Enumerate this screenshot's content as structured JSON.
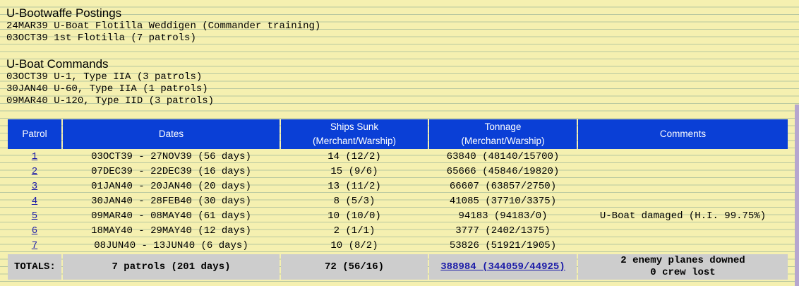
{
  "postings": {
    "title": "U-Bootwaffe Postings",
    "items": [
      "24MAR39 U-Boat Flotilla Weddigen (Commander training)",
      "03OCT39 1st Flotilla (7 patrols)"
    ]
  },
  "commands": {
    "title": "U-Boat Commands",
    "items": [
      "03OCT39 U-1, Type IIA (3 patrols)",
      "30JAN40 U-60, Type IIA (1 patrols)",
      "09MAR40 U-120, Type IID (3 patrols)"
    ]
  },
  "table": {
    "headers": {
      "patrol": "Patrol",
      "dates": "Dates",
      "ships_sunk": "Ships Sunk",
      "ships_sunk_sub": "(Merchant/Warship)",
      "tonnage": "Tonnage",
      "tonnage_sub": "(Merchant/Warship)",
      "comments": "Comments"
    },
    "header_color": "#0a3fd6",
    "rows": [
      {
        "patrol": "1",
        "dates": "03OCT39 - 27NOV39 (56 days)",
        "ships": "14 (12/2)",
        "tonnage": "63840 (48140/15700)",
        "comments": ""
      },
      {
        "patrol": "2",
        "dates": "07DEC39 - 22DEC39 (16 days)",
        "ships": "15 (9/6)",
        "tonnage": "65666 (45846/19820)",
        "comments": ""
      },
      {
        "patrol": "3",
        "dates": "01JAN40 - 20JAN40 (20 days)",
        "ships": "13 (11/2)",
        "tonnage": "66607 (63857/2750)",
        "comments": ""
      },
      {
        "patrol": "4",
        "dates": "30JAN40 - 28FEB40 (30 days)",
        "ships": "8 (5/3)",
        "tonnage": "41085 (37710/3375)",
        "comments": ""
      },
      {
        "patrol": "5",
        "dates": "09MAR40 - 08MAY40 (61 days)",
        "ships": "10 (10/0)",
        "tonnage": "94183 (94183/0)",
        "comments": "U-Boat damaged (H.I. 99.75%)"
      },
      {
        "patrol": "6",
        "dates": "18MAY40 - 29MAY40 (12 days)",
        "ships": "2 (1/1)",
        "tonnage": "3777 (2402/1375)",
        "comments": ""
      },
      {
        "patrol": "7",
        "dates": "08JUN40 - 13JUN40 (6 days)",
        "ships": "10 (8/2)",
        "tonnage": "53826 (51921/1905)",
        "comments": ""
      }
    ],
    "totals": {
      "label": "TOTALS:",
      "patrols": "7 patrols (201 days)",
      "ships": "72 (56/16)",
      "tonnage": "388984 (344059/44925)",
      "comments_line1": "2 enemy planes downed",
      "comments_line2": "0 crew lost"
    }
  }
}
